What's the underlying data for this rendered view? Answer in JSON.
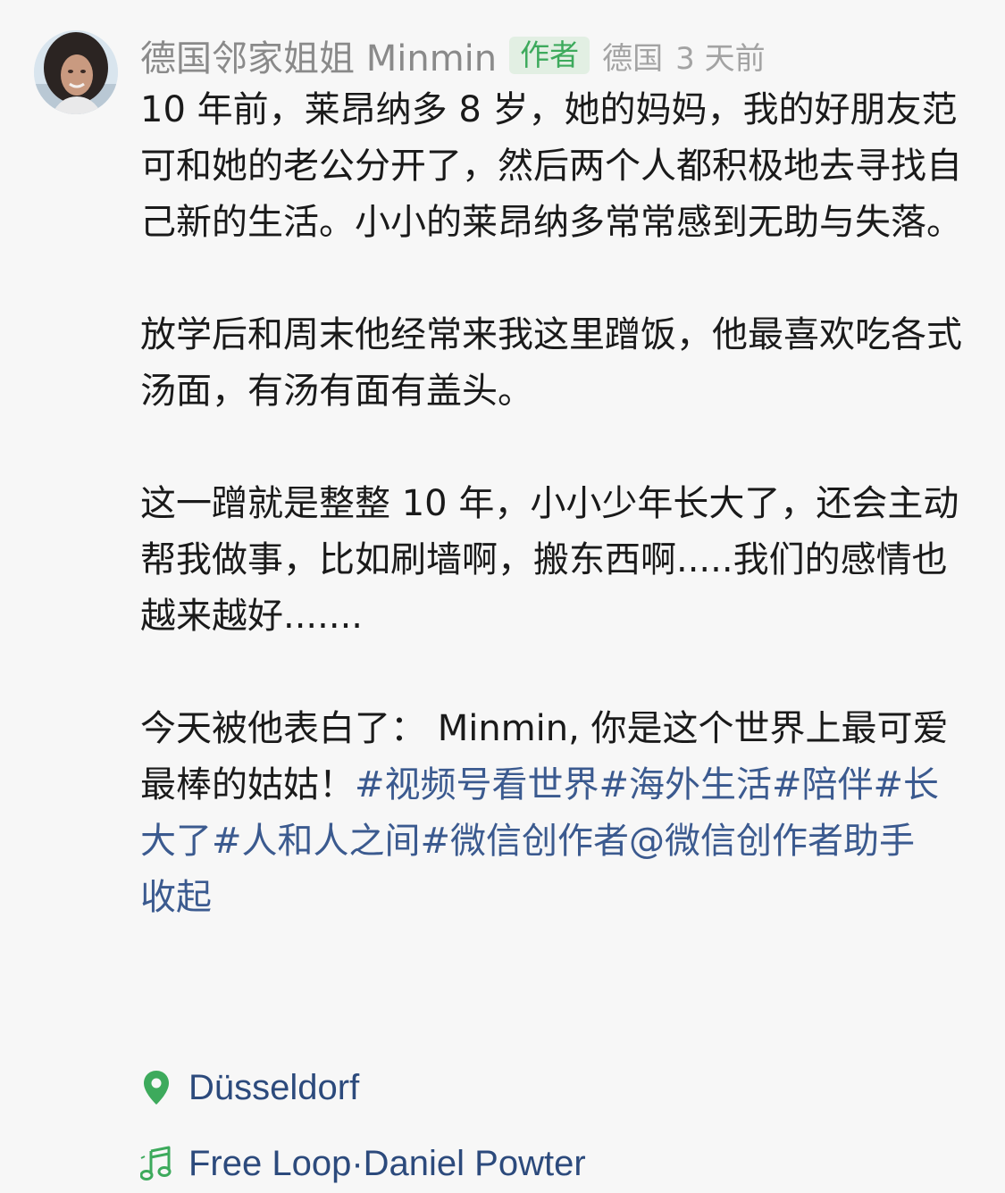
{
  "author": {
    "name": "德国邻家姐姐 Minmin",
    "badge": "作者",
    "region": "德国",
    "time": "3 天前"
  },
  "post": {
    "paragraph_1": "10 年前，莱昂纳多 8 岁，她的妈妈，我的好朋友范可和她的老公分开了，然后两个人都积极地去寻找自己新的生活。小小的莱昂纳多常常感到无助与失落。",
    "paragraph_2": "放学后和周末他经常来我这里蹭饭，他最喜欢吃各式汤面，有汤有面有盖头。",
    "paragraph_3": "这一蹭就是整整 10 年，小小少年长大了，还会主动帮我做事，比如刷墙啊，搬东西啊.....我们的感情也越来越好.......",
    "paragraph_4_text": "今天被他表白了： Minmin, 你是这个世界上最可爱最棒的姑姑！",
    "hashtags": "#视频号看世界#海外生活#陪伴#长大了#人和人之间#微信创作者@微信创作者助手",
    "collapse_label": "收起"
  },
  "location": {
    "icon": "location-pin-icon",
    "label": "Düsseldorf"
  },
  "music": {
    "icon": "music-note-icon",
    "label": "Free Loop·Daniel Powter"
  },
  "colors": {
    "background": "#f7f7f7",
    "badge_bg": "#e2efe3",
    "badge_text": "#3daa5c",
    "link": "#3b5a8f",
    "meta_text": "#2c4a7c",
    "icon_green": "#3daa5c",
    "muted": "#a3a3a3"
  }
}
